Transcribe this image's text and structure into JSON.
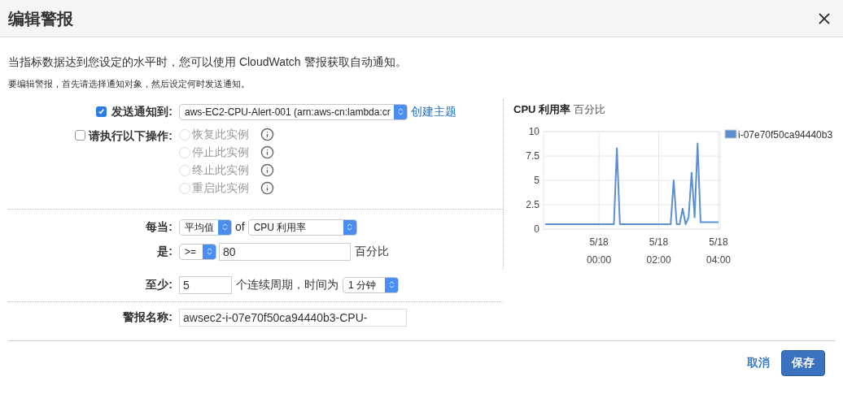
{
  "dialog": {
    "title": "编辑警报"
  },
  "intro": "当指标数据达到您设定的水平时，您可以使用 CloudWatch 警报获取自动通知。",
  "hint": "要编辑警报，首先请选择通知对象，然后设定何时发送通知。",
  "notify": {
    "label": "发送通知到:",
    "checked": true,
    "value": "aws-EC2-CPU-Alert-001 (arn:aws-cn:lambda:cr",
    "link": "创建主题"
  },
  "actions": {
    "label": "请执行以下操作:",
    "checked": false,
    "options": [
      {
        "label": "恢复此实例",
        "selected": false,
        "disabled": true
      },
      {
        "label": "停止此实例",
        "selected": false,
        "disabled": true
      },
      {
        "label": "终止此实例",
        "selected": false,
        "disabled": true
      },
      {
        "label": "重启此实例",
        "selected": false,
        "disabled": true
      }
    ]
  },
  "whenever": {
    "label": "每当:",
    "statistic": "平均值",
    "of": "of",
    "metric": "CPU 利用率"
  },
  "is": {
    "label": "是:",
    "operator": ">=",
    "value": "80",
    "unit": "百分比"
  },
  "for": {
    "label": "至少:",
    "value": "5",
    "text": "个连续周期，时间为",
    "period": "1 分钟"
  },
  "name": {
    "label": "警报名称:",
    "value": "awsec2-i-07e70f50ca94440b3-CPU-"
  },
  "chart": {
    "title": "CPU 利用率",
    "unit": "百分比",
    "chart_data": {
      "type": "line",
      "grid": true,
      "ylim": [
        0,
        10
      ],
      "yticks": [
        0,
        {
          "value": 2.5,
          "label": "2.5"
        },
        5,
        {
          "value": 7.5,
          "label": "7.5"
        },
        10
      ],
      "categories": [
        null,
        null,
        null,
        null,
        null,
        null,
        null,
        null,
        null,
        null,
        null,
        null,
        null,
        null,
        null,
        null,
        null,
        null,
        "5/18\n00:00",
        null,
        null,
        null,
        null,
        null,
        null,
        null,
        null,
        null,
        null,
        null,
        null,
        null,
        null,
        null,
        null,
        null,
        null,
        null,
        "5/18\n02:00",
        null,
        null,
        null,
        null,
        null,
        null,
        null,
        null,
        null,
        null,
        null,
        null,
        null,
        null,
        null,
        null,
        null,
        null,
        null,
        "5/18\n04:00"
      ],
      "series": [
        {
          "name": "i-07e70f50ca94440b3",
          "color": "#5b8fcf",
          "values": [
            0.5,
            0.5,
            0.5,
            0.5,
            0.5,
            0.5,
            0.5,
            0.5,
            0.5,
            0.5,
            0.5,
            0.5,
            0.5,
            0.5,
            0.5,
            0.5,
            0.5,
            0.5,
            0.5,
            0.5,
            0.5,
            0.5,
            0.5,
            0.5,
            8.3,
            0.5,
            0.5,
            0.5,
            0.5,
            0.5,
            0.5,
            0.5,
            0.5,
            0.5,
            0.5,
            0.5,
            0.5,
            0.5,
            0.5,
            0.5,
            0.5,
            0.5,
            0.5,
            5.0,
            0.5,
            0.5,
            2.1,
            0.5,
            1.2,
            5.8,
            1.2,
            8.8,
            0.7,
            0.7,
            0.7,
            0.7,
            0.7,
            0.7,
            0.7
          ]
        }
      ]
    }
  },
  "buttons": {
    "cancel": "取消",
    "save": "保存"
  }
}
